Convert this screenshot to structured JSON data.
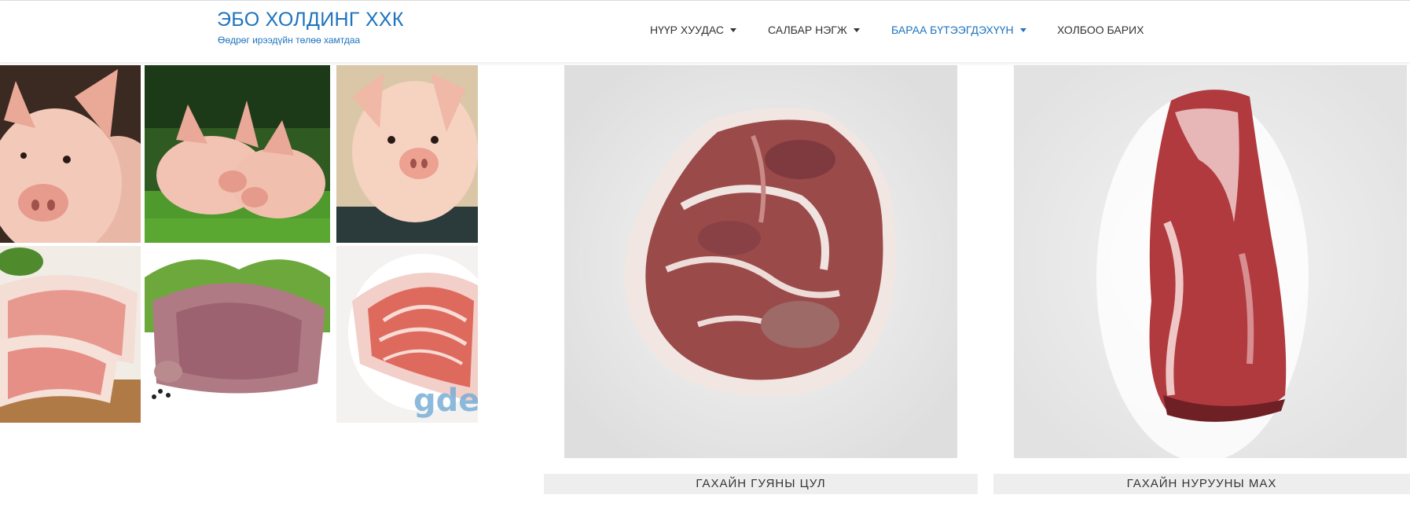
{
  "header": {
    "brand_title": "ЭБО ХОЛДИНГ ХХК",
    "brand_tagline": "Өөдрөг ирээдүйн төлөө хамтдаа",
    "nav": [
      {
        "label": "НҮҮР ХУУДАС",
        "has_dropdown": true,
        "active": false
      },
      {
        "label": "САЛБАР НЭГЖ",
        "has_dropdown": true,
        "active": false
      },
      {
        "label": "БАРАА БҮТЭЭГДЭХҮҮН",
        "has_dropdown": true,
        "active": true
      },
      {
        "label": "ХОЛБОО БАРИХ",
        "has_dropdown": false,
        "active": false
      }
    ]
  },
  "collage": {
    "watermark": "gde",
    "tiles": [
      "piglet-photo",
      "two-piglets-on-grass-photo",
      "smiling-piglet-photo",
      "pork-chops-photo",
      "pork-roast-with-lettuce-photo",
      "sliced-ham-photo"
    ]
  },
  "products": [
    {
      "name": "ГАХАЙН ГУЯНЫ ЦУЛ"
    },
    {
      "name": "ГАХАЙН НУРУУНЫ МАХ"
    }
  ],
  "colors": {
    "accent": "#1e73be",
    "text": "#333333",
    "label_bg": "#eeeeee"
  }
}
